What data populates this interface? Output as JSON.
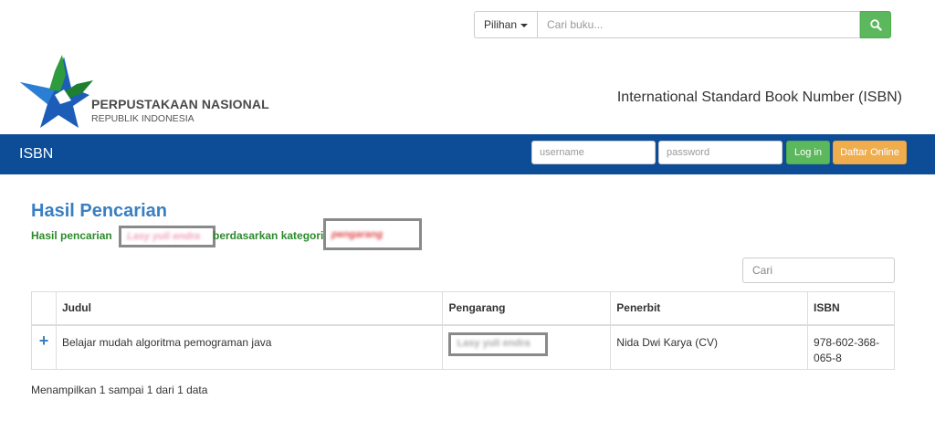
{
  "top_search": {
    "dropdown_label": "Pilihan",
    "placeholder": "Cari buku...",
    "button_color": "#5cb85c"
  },
  "logo": {
    "line1": "PERPUSTAKAAN NASIONAL",
    "line2": "REPUBLIK INDONESIA"
  },
  "header_title": "International Standard Book Number (ISBN)",
  "navbar": {
    "brand": "ISBN",
    "username_placeholder": "username",
    "password_placeholder": "password",
    "login_label": "Log in",
    "daftar_label": "Daftar Online",
    "background": "#0d4c96"
  },
  "results": {
    "heading": "Hasil Pencarian",
    "prefix": "Hasil pencarian",
    "query_redacted": "Lasy yuli endra",
    "middle": "berdasarkan kategori",
    "category_redacted": "pengarang"
  },
  "filter_placeholder": "Cari",
  "table": {
    "columns": [
      "",
      "Judul",
      "Pengarang",
      "Penerbit",
      "ISBN"
    ],
    "rows": [
      {
        "expand": "+",
        "judul": "Belajar mudah algoritma pemograman java",
        "pengarang_redacted": "Lasy yuli endra",
        "penerbit": "Nida Dwi Karya (CV)",
        "isbn": "978-602-368-065-8"
      }
    ]
  },
  "footer_info": "Menampilkan 1 sampai 1 dari 1 data"
}
